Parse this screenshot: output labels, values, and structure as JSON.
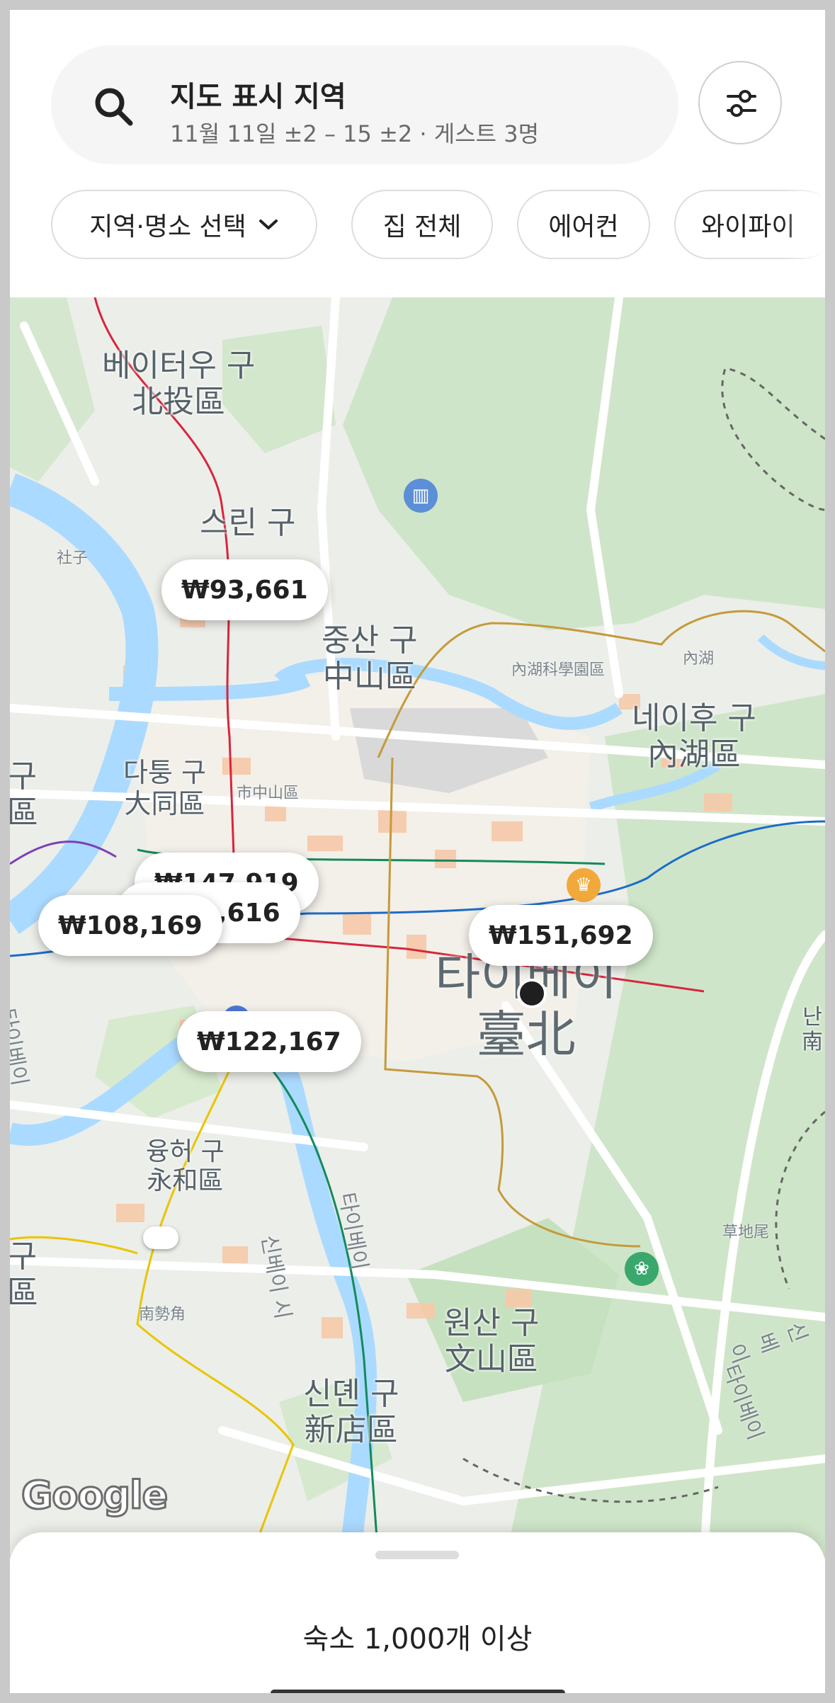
{
  "search": {
    "title": "지도 표시 지역",
    "subtitle": "11월 11일 ±2 – 15 ±2 · 게스트 3명"
  },
  "chips": [
    {
      "label": "지역·명소 선택"
    },
    {
      "label": "집 전체"
    },
    {
      "label": "에어컨"
    },
    {
      "label": "와이파이"
    }
  ],
  "map": {
    "areas": {
      "beitou_ko": "베이터우 구",
      "beitou_zh": "北投區",
      "shilin_ko": "스린 구",
      "zhongshan_ko": "중산 구",
      "zhongshan_zh": "中山區",
      "neihu_ko": "네이후 구",
      "neihu_zh": "內湖區",
      "datong_ko": "다퉁 구",
      "datong_zh": "大同區",
      "taipei_ko": "타이베이",
      "taipei_zh": "臺北",
      "yonghe_ko": "융허 구",
      "yonghe_zh": "永和區",
      "wenshan_ko": "원산 구",
      "wenshan_zh": "文山區",
      "xindian_ko": "신뎬 구",
      "xindian_zh": "新店區"
    },
    "small_labels": {
      "shezi": "社子",
      "neihu_sci": "內湖科學園區",
      "neihu": "內湖",
      "zhongshan_station": "市中山區",
      "caodiwei": "草地尾",
      "nanshijiao": "南勢角",
      "road_taipei_1": "타이베이",
      "road_taipei_2": "타이베이",
      "road_xinbei_1": "신베이 시",
      "road_taipei_3": "타이베이",
      "road_xinbei_2": "신베이",
      "left_edge_1": "구",
      "left_edge_2": "區",
      "right_edge_1": "난",
      "right_edge_2": "南"
    },
    "prices": [
      {
        "label": "₩93,661"
      },
      {
        "label": "₩147,919"
      },
      {
        "label": "₩149,616"
      },
      {
        "label": "₩108,169"
      },
      {
        "label": "₩151,692"
      },
      {
        "label": "₩122,167"
      }
    ],
    "google_label": "Google"
  },
  "sheet": {
    "listing_count": "숙소 1,000개 이상"
  },
  "colors": {
    "text_primary": "#222222",
    "water": "#aadaff",
    "park": "#c8e6c2",
    "metro_red": "#d7263d",
    "metro_green": "#138a5c",
    "metro_blue": "#1c6cc8"
  }
}
